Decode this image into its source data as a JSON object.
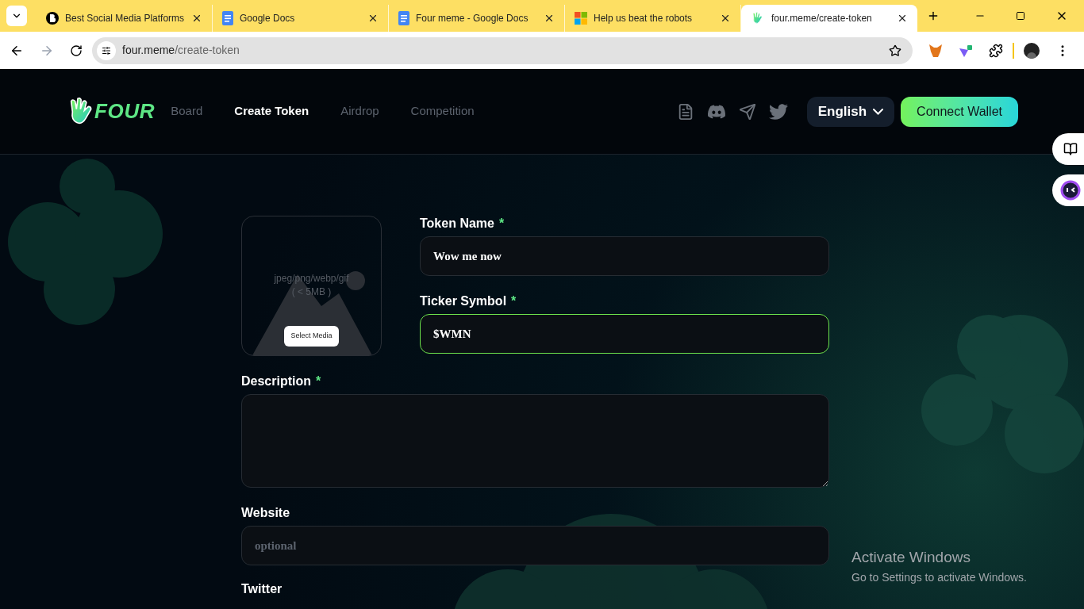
{
  "browser": {
    "tabs": [
      {
        "title": "Best Social Media Platforms",
        "kind": "b",
        "selected": false
      },
      {
        "title": "Google Docs",
        "kind": "docs",
        "selected": false
      },
      {
        "title": "Four meme - Google Docs",
        "kind": "docs",
        "selected": false
      },
      {
        "title": "Help us beat the robots",
        "kind": "windows",
        "selected": false
      },
      {
        "title": "four.meme/create-token",
        "kind": "hand",
        "selected": true
      }
    ],
    "address": {
      "host": "four.meme",
      "path": "/create-token"
    }
  },
  "header": {
    "logo": "FOUR",
    "nav": [
      {
        "label": "Board",
        "selected": false
      },
      {
        "label": "Create Token",
        "selected": true
      },
      {
        "label": "Airdrop",
        "selected": false
      },
      {
        "label": "Competition",
        "selected": false
      }
    ],
    "language": "English",
    "connect": "Connect Wallet"
  },
  "upload": {
    "formats": "jpeg/png/webp/gif",
    "limit": "( < 5MB )",
    "button": "Select Media"
  },
  "fields": [
    {
      "kind": "input",
      "label": "Token Name",
      "required": true,
      "value": "Wow me now",
      "focused": false
    },
    {
      "kind": "input",
      "label": "Ticker Symbol",
      "required": true,
      "value": "$WMN",
      "focused": true
    },
    {
      "kind": "textarea",
      "label": "Description",
      "required": true,
      "focused": false
    },
    {
      "kind": "input",
      "label": "Website",
      "required": false,
      "placeholder": "optional",
      "focused": false
    },
    {
      "kind": "label",
      "label": "Twitter",
      "required": false
    }
  ],
  "required_mark": "*",
  "activation": {
    "title": "Activate Windows",
    "subtitle": "Go to Settings to activate Windows."
  }
}
